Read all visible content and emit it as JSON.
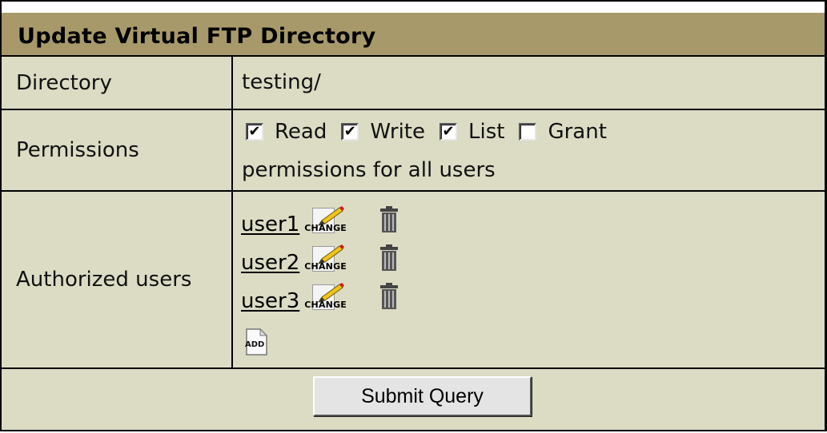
{
  "form": {
    "title": "Update Virtual FTP Directory",
    "directory": {
      "label": "Directory",
      "value": "testing/"
    },
    "permissions": {
      "label": "Permissions",
      "options": [
        {
          "label": "Read",
          "checked": true
        },
        {
          "label": "Write",
          "checked": true
        },
        {
          "label": "List",
          "checked": true
        },
        {
          "label": "Grant",
          "checked": false
        }
      ],
      "note": "permissions for all users"
    },
    "authorized_users": {
      "label": "Authorized users",
      "users": [
        "user1",
        "user2",
        "user3"
      ],
      "change_icon_text": "CHANGE",
      "add_icon_text": "ADD"
    },
    "submit_label": "Submit Query"
  },
  "colors": {
    "header_bg": "#a8996a",
    "panel_bg": "#dcdcc5",
    "border": "#000000"
  },
  "icons": {
    "change": "pencil-edit-icon",
    "delete": "trash-icon",
    "add": "add-document-icon",
    "checked": "checkmark"
  }
}
